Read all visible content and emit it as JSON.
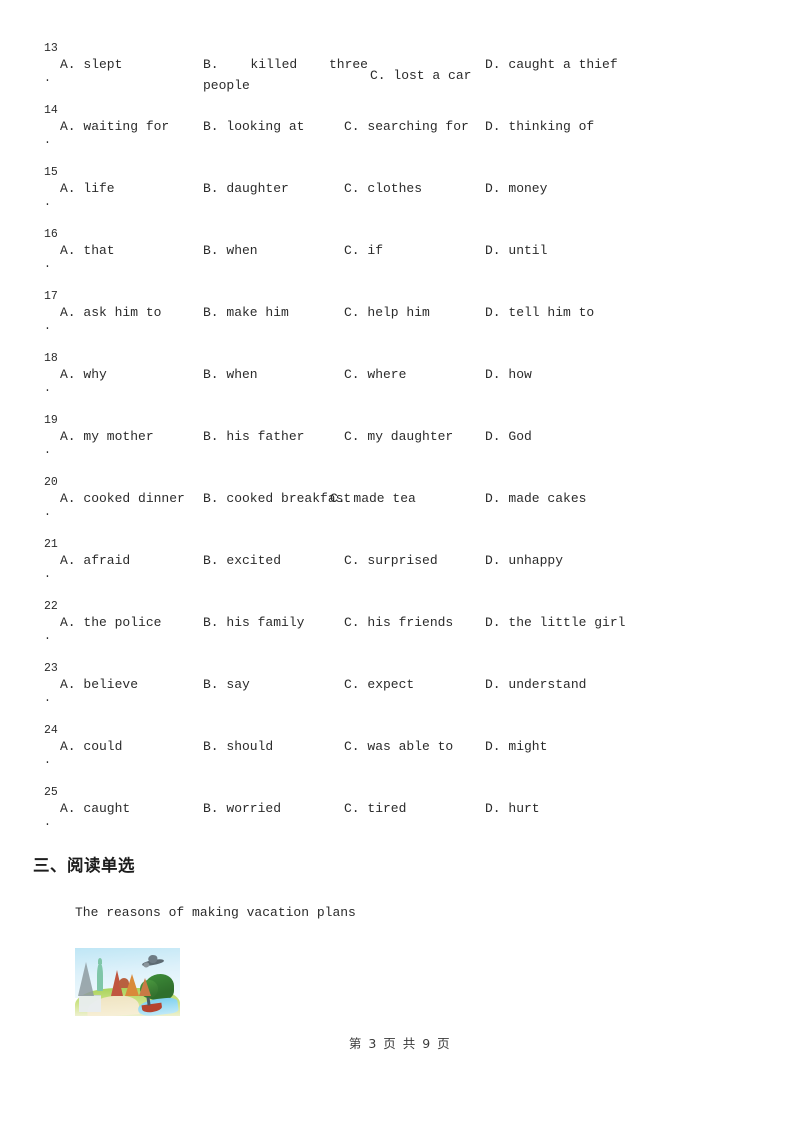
{
  "document": {
    "questions": [
      {
        "number": "13",
        "number_suffix": ".",
        "options": {
          "a": "A. slept",
          "b": "B. killed three people",
          "c": "C. lost a car",
          "d": "D. caught a thief"
        },
        "layout": "wrapB"
      },
      {
        "number": "14",
        "number_suffix": ".",
        "options": {
          "a": "A. waiting for",
          "b": "B. looking at",
          "c": "C. searching for",
          "d": "D. thinking of"
        },
        "layout": "normal"
      },
      {
        "number": "15",
        "number_suffix": ".",
        "options": {
          "a": "A. life",
          "b": "B. daughter",
          "c": "C. clothes",
          "d": "D. money"
        },
        "layout": "normal"
      },
      {
        "number": "16",
        "number_suffix": ".",
        "options": {
          "a": "A. that",
          "b": "B. when",
          "c": "C. if",
          "d": "D. until"
        },
        "layout": "normal"
      },
      {
        "number": "17",
        "number_suffix": ".",
        "options": {
          "a": "A. ask him to",
          "b": "B. make him",
          "c": "C. help him",
          "d": "D. tell him to"
        },
        "layout": "normal"
      },
      {
        "number": "18",
        "number_suffix": ".",
        "options": {
          "a": "A. why",
          "b": "B. when",
          "c": "C. where",
          "d": "D. how"
        },
        "layout": "normal"
      },
      {
        "number": "19",
        "number_suffix": ".",
        "options": {
          "a": "A. my mother",
          "b": "B. his father",
          "c": "C. my daughter",
          "d": "D. God"
        },
        "layout": "normal"
      },
      {
        "number": "20",
        "number_suffix": ".",
        "options": {
          "a": "A. cooked dinner",
          "b": "B. cooked breakfast",
          "c": "C. made tea",
          "d": "D. made cakes"
        },
        "layout": "tightC"
      },
      {
        "number": "21",
        "number_suffix": ".",
        "options": {
          "a": "A. afraid",
          "b": "B. excited",
          "c": "C. surprised",
          "d": "D. unhappy"
        },
        "layout": "normal"
      },
      {
        "number": "22",
        "number_suffix": ".",
        "options": {
          "a": "A. the police",
          "b": "B. his family",
          "c": "C. his friends",
          "d": "D. the little girl"
        },
        "layout": "normal"
      },
      {
        "number": "23",
        "number_suffix": ".",
        "options": {
          "a": "A. believe",
          "b": "B. say",
          "c": "C. expect",
          "d": "D. understand"
        },
        "layout": "normal"
      },
      {
        "number": "24",
        "number_suffix": ".",
        "options": {
          "a": "A. could",
          "b": "B. should",
          "c": "C. was able to",
          "d": "D. might"
        },
        "layout": "normal"
      },
      {
        "number": "25",
        "number_suffix": ".",
        "options": {
          "a": "A. caught",
          "b": "B. worried",
          "c": "C. tired",
          "d": "D. hurt"
        },
        "layout": "normal"
      }
    ],
    "section_heading": "三、阅读单选",
    "passage_title": "The reasons of making vacation plans",
    "figure": {
      "alt": "travel-collage-illustration"
    },
    "footer": "第 3 页 共 9 页"
  }
}
